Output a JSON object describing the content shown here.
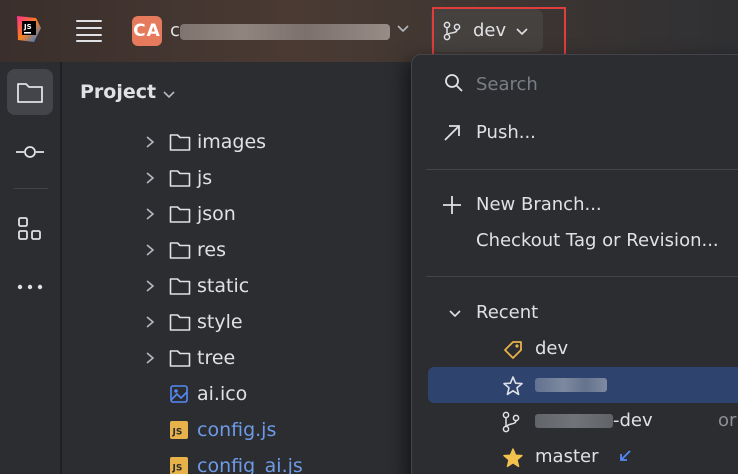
{
  "titlebar": {
    "project_badge": "CA",
    "project_name_initial": "c",
    "branch": "dev"
  },
  "toolstrip": {
    "items": [
      {
        "icon": "folder-icon",
        "active": true
      },
      {
        "icon": "commit-icon",
        "active": false
      },
      {
        "icon": "structure-icon",
        "active": false
      },
      {
        "icon": "more-icon",
        "active": false
      }
    ]
  },
  "project_panel": {
    "title": "Project",
    "tree": [
      {
        "label": "images",
        "type": "folder"
      },
      {
        "label": "js",
        "type": "folder"
      },
      {
        "label": "json",
        "type": "folder"
      },
      {
        "label": "res",
        "type": "folder"
      },
      {
        "label": "static",
        "type": "folder"
      },
      {
        "label": "style",
        "type": "folder"
      },
      {
        "label": "tree",
        "type": "folder"
      },
      {
        "label": "ai.ico",
        "type": "image"
      },
      {
        "label": "config.js",
        "type": "js"
      },
      {
        "label": "config_ai.js",
        "type": "js"
      }
    ]
  },
  "popup": {
    "search_placeholder": "Search",
    "push_label": "Push...",
    "new_branch_label": "New Branch...",
    "checkout_label": "Checkout Tag or Revision...",
    "recent_label": "Recent",
    "branches": [
      {
        "label": "dev",
        "icon": "tag-icon"
      },
      {
        "label": "",
        "icon": "star-outline-icon"
      },
      {
        "label": "-dev",
        "icon": "branch-icon",
        "trail": "or"
      },
      {
        "label": "master",
        "icon": "star-filled-icon"
      }
    ]
  },
  "colors": {
    "accent": "#e57a5c",
    "selection": "#2e436e",
    "highlight": "#e03d3d",
    "js_file": "#6e9be8"
  }
}
